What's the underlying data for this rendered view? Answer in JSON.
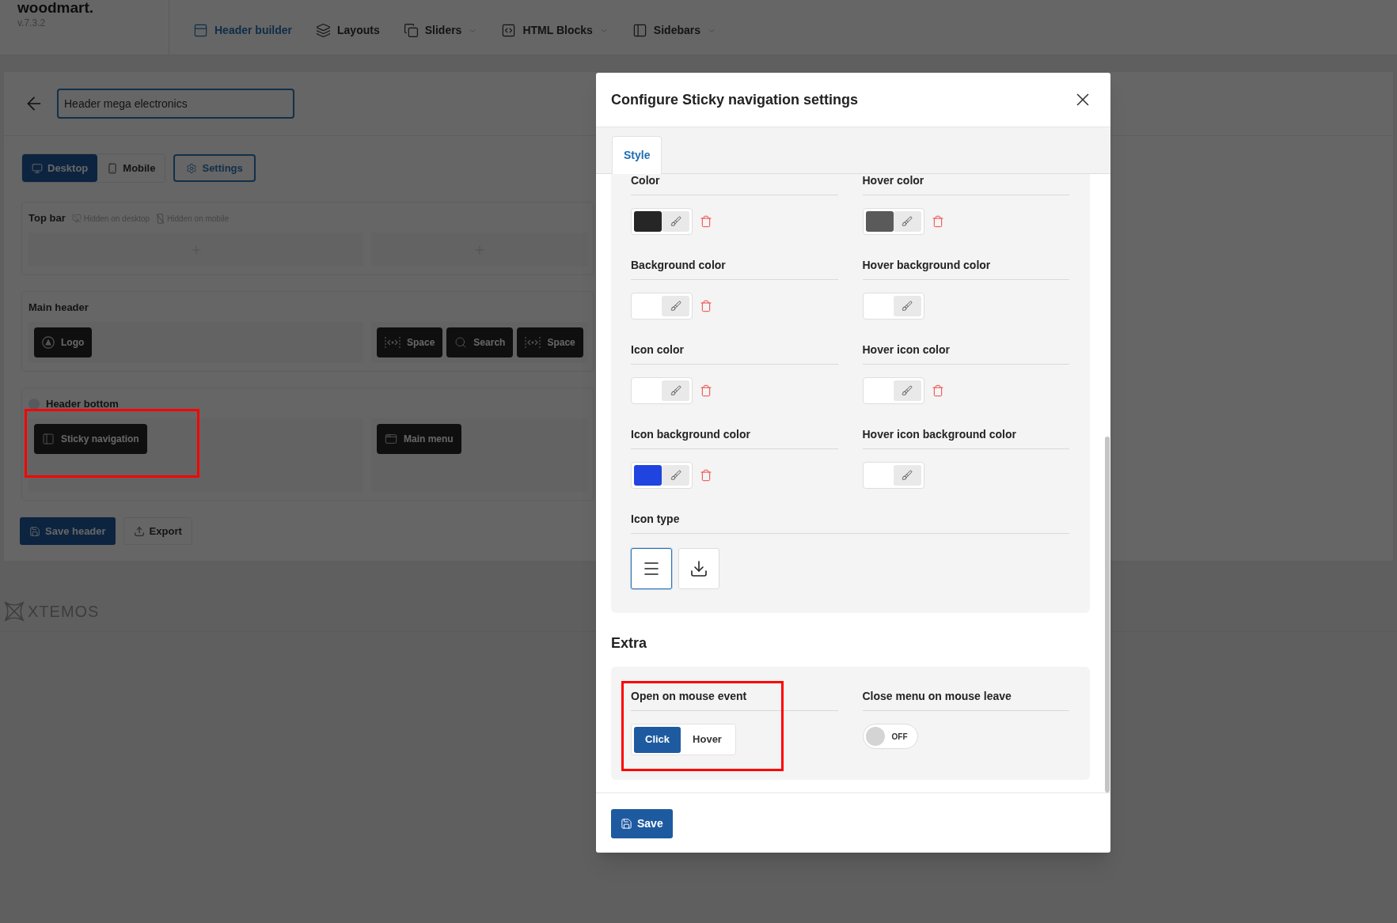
{
  "app_header": {
    "logo": "woodmart.",
    "version": "v.7.3.2",
    "nav": [
      {
        "label": "Header builder",
        "selected": true,
        "dropdown": false
      },
      {
        "label": "Layouts",
        "selected": false,
        "dropdown": false
      },
      {
        "label": "Sliders",
        "selected": false,
        "dropdown": true
      },
      {
        "label": "HTML Blocks",
        "selected": false,
        "dropdown": true
      },
      {
        "label": "Sidebars",
        "selected": false,
        "dropdown": true
      }
    ]
  },
  "builder": {
    "name_field": {
      "value": "Header mega electronics"
    },
    "device_tabs": [
      {
        "label": "Desktop",
        "selected": true
      },
      {
        "label": "Mobile",
        "selected": false
      }
    ],
    "settings_button": "Settings",
    "rows": [
      {
        "title": "Top bar",
        "dot": false,
        "badges": [
          "Hidden on desktop",
          "Hidden on mobile"
        ],
        "zones": [
          {
            "empty": true
          },
          {
            "empty": true
          }
        ]
      },
      {
        "title": "Main header",
        "dot": false,
        "zones": [
          {
            "empty": false,
            "elements": [
              {
                "label": "Logo",
                "kind": "logo",
                "highlighted": false
              }
            ]
          },
          {
            "empty": false,
            "elements": [
              {
                "label": "Space",
                "kind": "space",
                "highlighted": false
              },
              {
                "label": "Search",
                "kind": "search",
                "highlighted": false
              },
              {
                "label": "Space",
                "kind": "space",
                "highlighted": false
              }
            ]
          }
        ]
      },
      {
        "title": "Header bottom",
        "dot": true,
        "zones": [
          {
            "empty": false,
            "elements": [
              {
                "label": "Sticky navigation",
                "kind": "sticky",
                "highlighted": true
              }
            ]
          },
          {
            "empty": false,
            "elements": [
              {
                "label": "Main menu",
                "kind": "menu",
                "highlighted": false
              }
            ]
          }
        ]
      }
    ],
    "actions": [
      {
        "label": "Save header",
        "kind": "primary"
      },
      {
        "label": "Export",
        "kind": "secondary"
      }
    ]
  },
  "footer": {
    "logo": "XTEMOS"
  },
  "dialog": {
    "title": "Configure Sticky navigation settings",
    "tabs": [
      {
        "label": "Style",
        "selected": true
      }
    ],
    "style_fields": [
      {
        "label": "Color",
        "color": "#262626",
        "clearable": true
      },
      {
        "label": "Hover color",
        "color": "#5a5a5a",
        "clearable": true
      },
      {
        "label": "Background color",
        "clearable": true
      },
      {
        "label": "Hover background color",
        "clearable": false
      },
      {
        "label": "Icon color",
        "clearable": true
      },
      {
        "label": "Hover icon color",
        "clearable": true
      },
      {
        "label": "Icon background color",
        "color": "#1f44e0",
        "clearable": true
      },
      {
        "label": "Hover icon background color",
        "clearable": false
      }
    ],
    "icon_type": {
      "label": "Icon type",
      "options": [
        {
          "kind": "hamburger",
          "selected": true
        },
        {
          "kind": "download",
          "selected": false
        }
      ]
    },
    "extra": {
      "heading": "Extra",
      "open_event": {
        "label": "Open on mouse event",
        "highlighted": true,
        "options": [
          {
            "label": "Click",
            "selected": true
          },
          {
            "label": "Hover",
            "selected": false
          }
        ]
      },
      "close_on_leave": {
        "label": "Close menu on mouse leave",
        "on": false,
        "state_text": "OFF"
      }
    },
    "save_button": "Save"
  }
}
